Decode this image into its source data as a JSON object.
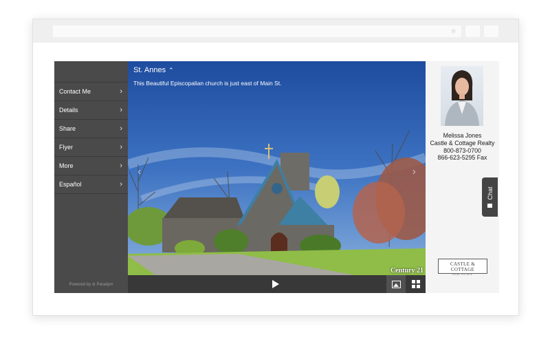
{
  "browser": {
    "url_bar_value": "",
    "bookmark_icon": "star-icon",
    "window_buttons": [
      "minimize-icon",
      "maximize-icon"
    ]
  },
  "sidebar": {
    "items": [
      {
        "label": "Contact Me",
        "icon": "chevron-right-icon"
      },
      {
        "label": "Details",
        "icon": "chevron-right-icon"
      },
      {
        "label": "Share",
        "icon": "chevron-right-icon"
      },
      {
        "label": "Flyer",
        "icon": "chevron-right-icon"
      },
      {
        "label": "More",
        "icon": "chevron-right-icon"
      },
      {
        "label": "Español",
        "icon": "chevron-right-icon"
      }
    ],
    "powered_by": "Powered by",
    "powered_brand": "Paradym"
  },
  "photo": {
    "title": "St. Annes",
    "title_icon": "chevron-up-icon",
    "description": "This Beautiful Episcopalian church is just east of Main St.",
    "prev_icon": "chevron-left-icon",
    "next_icon": "chevron-right-icon",
    "watermark": "Century 21"
  },
  "controls": {
    "play_icon": "play-icon",
    "gallery_icon": "image-icon",
    "thumbnails_icon": "grid-icon"
  },
  "agent": {
    "name": "Melissa Jones",
    "company": "Castle & Cottage Realty",
    "phone": "800-873-0700",
    "fax": "866-623-5295 Fax",
    "chat_label": "Chat",
    "chat_icon": "chat-bubble-icon",
    "logo_line1": "CASTLE & COTTAGE",
    "logo_line2": "REAL ESTATE"
  },
  "colors": {
    "sidebar": "#4a4a4a",
    "control_bar": "#383838",
    "sky": "#2c5aa7",
    "roof": "#3e7fa4"
  }
}
